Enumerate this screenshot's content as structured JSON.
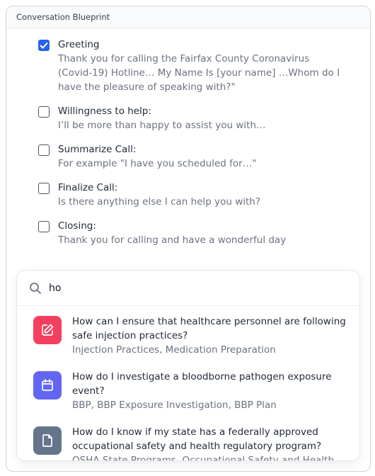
{
  "panel": {
    "title": "Conversation Blueprint"
  },
  "checklist": [
    {
      "checked": true,
      "title": "Greeting",
      "desc": "Thank you for calling the Fairfax County Coronavirus (Covid-19) Hotline… My Name Is [your name] …Whom do I have the pleasure of speaking with?\""
    },
    {
      "checked": false,
      "title": "Willingness to help:",
      "desc": "I’ll be more than happy to assist you with…"
    },
    {
      "checked": false,
      "title": "Summarize Call:",
      "desc": "For example \"I have you scheduled for…\""
    },
    {
      "checked": false,
      "title": "Finalize Call:",
      "desc": "Is there anything else I can help you with?"
    },
    {
      "checked": false,
      "title": "Closing:",
      "desc": "Thank you for calling and have a wonderful day"
    }
  ],
  "search": {
    "value": "ho",
    "icon": "search-icon"
  },
  "results": [
    {
      "icon": "edit-icon",
      "color": "#f43f5e",
      "question": "How can I ensure that healthcare personnel are following safe injection practices?",
      "tags": "Injection Practices, Medication Preparation"
    },
    {
      "icon": "calendar-icon",
      "color": "#6366f1",
      "question": "How do I investigate a bloodborne pathogen exposure event?",
      "tags": "BBP, BBP Exposure Investigation, BBP Plan"
    },
    {
      "icon": "document-icon",
      "color": "#64748b",
      "question": "How do I know if my state has a federally approved occupational safety and health regulatory program?",
      "tags": "OSHA State Programs, Occupational Safety and Health"
    }
  ]
}
